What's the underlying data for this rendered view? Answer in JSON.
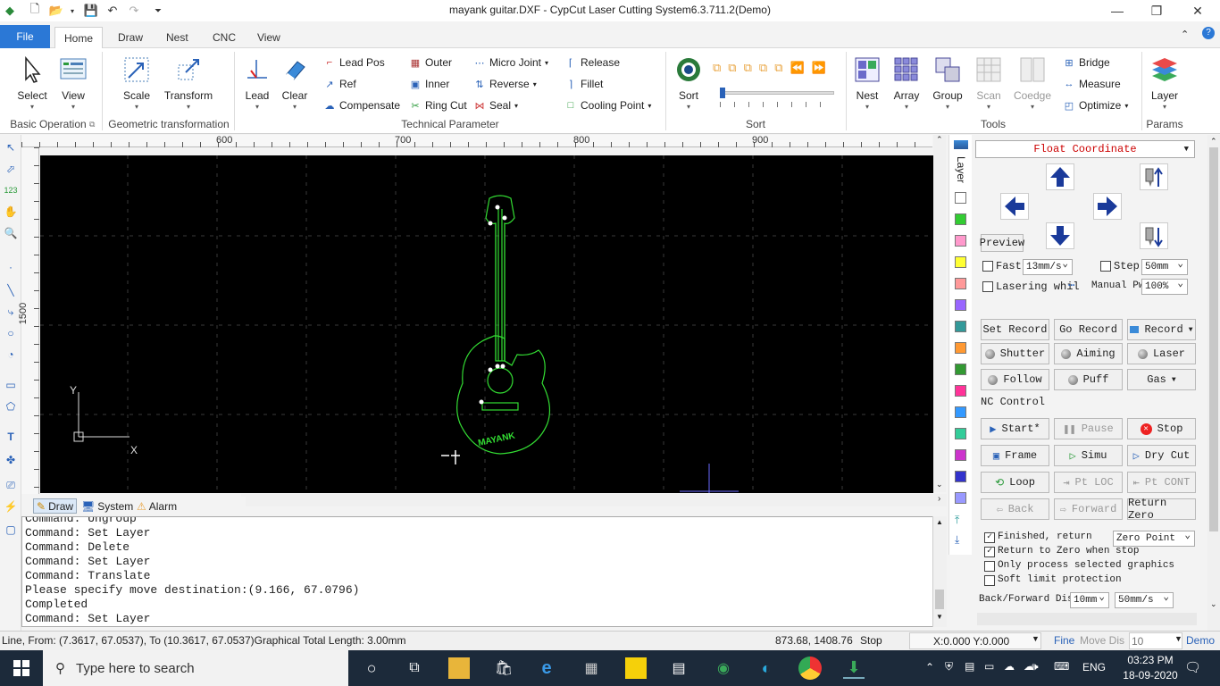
{
  "window": {
    "title": "mayank guitar.DXF - CypCut Laser Cutting System6.3.711.2(Demo)"
  },
  "tabs": [
    "File",
    "Home",
    "Draw",
    "Nest",
    "CNC",
    "View"
  ],
  "ribbon": {
    "select": "Select",
    "view": "View",
    "scale": "Scale",
    "transform": "Transform",
    "lead": "Lead",
    "clear": "Clear",
    "lead_pos": "Lead Pos",
    "ref": "Ref",
    "compensate": "Compensate",
    "outer": "Outer",
    "inner": "Inner",
    "ring_cut": "Ring Cut",
    "micro_joint": "Micro Joint",
    "reverse": "Reverse",
    "seal": "Seal",
    "release": "Release",
    "fillet": "Fillet",
    "cooling_point": "Cooling Point",
    "sort": "Sort",
    "nest": "Nest",
    "array": "Array",
    "group": "Group",
    "scan": "Scan",
    "coedge": "Coedge",
    "bridge": "Bridge",
    "measure": "Measure",
    "optimize": "Optimize",
    "layer": "Layer",
    "groups": {
      "basic": "Basic Operation",
      "geo": "Geometric transformation",
      "tech": "Technical Parameter",
      "sort": "Sort",
      "tools": "Tools",
      "params": "Params"
    }
  },
  "ruler": {
    "top": [
      "600",
      "700",
      "800",
      "900"
    ],
    "left": "1500"
  },
  "canvas": {
    "guitar_text": "MAYANK",
    "axis_x": "X",
    "axis_y": "Y"
  },
  "layer_label": "Layer",
  "layer_colors": [
    "#ffffff",
    "#33cc33",
    "#ff99cc",
    "#ffff33",
    "#ff9999",
    "#9966ff",
    "#339999",
    "#ff9933",
    "#339933",
    "#ff3399",
    "#3399ff",
    "#33cc99",
    "#cc33cc",
    "#3333cc",
    "#9999ff"
  ],
  "bottom_tabs": {
    "draw": "Draw",
    "system": "System",
    "alarm": "Alarm"
  },
  "command_lines": [
    "Command: Ungroup",
    "Command: Set Layer",
    "Command: Delete",
    "Command: Set Layer",
    "Command: Translate",
    "Please specify move destination:(9.166, 67.0796)",
    "Completed",
    "Command: Set Layer"
  ],
  "panel": {
    "coord_mode": "Float Coordinate",
    "preview": "Preview",
    "fast": "Fast",
    "fast_speed": "13mm/s",
    "step": "Step",
    "step_val": "50mm",
    "lasering": "Lasering whil",
    "manual_pw": "Manual Pw",
    "manual_pw_val": "100%",
    "set_record": "Set Record",
    "go_record": "Go Record",
    "record": "Record",
    "shutter": "Shutter",
    "aiming": "Aiming",
    "laser": "Laser",
    "follow": "Follow",
    "puff": "Puff",
    "gas": "Gas",
    "nc_control": "NC Control",
    "start": "Start*",
    "pause": "Pause",
    "stop": "Stop",
    "frame": "Frame",
    "simu": "Simu",
    "dry_cut": "Dry Cut",
    "loop": "Loop",
    "pt_loc": "Pt LOC",
    "pt_cont": "Pt CONT",
    "back": "Back",
    "forward": "Forward",
    "return_zero": "Return Zero",
    "finished_return": "Finished, return",
    "zero_point": "Zero Point",
    "return_zero_stop": "Return to Zero when stop",
    "only_selected": "Only process selected graphics",
    "soft_limit": "Soft limit protection",
    "back_forward_dis": "Back/Forward Dis:",
    "bf_dis_val": "10mm",
    "bf_speed_val": "50mm/s"
  },
  "status": {
    "info": "Line, From: (7.3617, 67.0537), To (10.3617, 67.0537)Graphical Total Length: 3.00mm",
    "coords": "873.68, 1408.76",
    "state": "Stop",
    "machine": "X:0.000 Y:0.000",
    "fine": "Fine",
    "move_dis": "Move Dis",
    "move_val": "10",
    "demo": "Demo"
  },
  "taskbar": {
    "search_placeholder": "Type here to search",
    "lang": "ENG",
    "time": "03:23 PM",
    "date": "18-09-2020"
  }
}
